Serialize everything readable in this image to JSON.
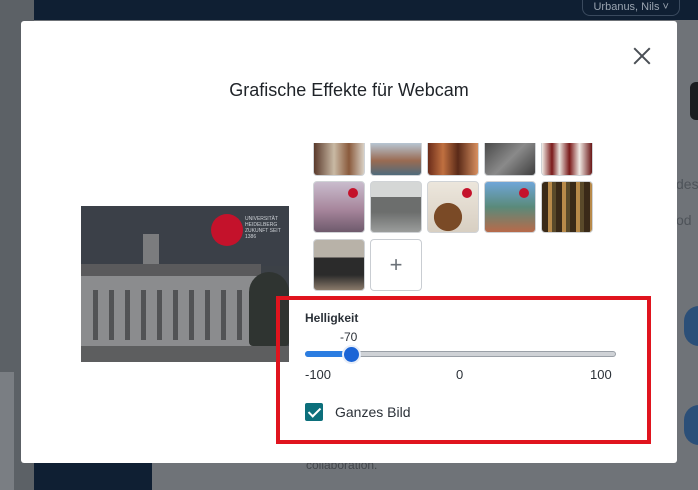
{
  "background": {
    "user_name": "Urbanus, Nils ˅",
    "right_text_1": "des",
    "right_text_2": "od",
    "footer_text": "collaboration."
  },
  "dialog": {
    "title": "Grafische Effekte für Webcam",
    "close_icon": "close-icon"
  },
  "preview": {
    "logo_text": "UNIVERSITÄT HEIDELBERG ZUKUNFT SEIT 1386"
  },
  "thumbnails": [
    {
      "name": "interior-hall",
      "selected": false
    },
    {
      "name": "bridge-river",
      "selected": false
    },
    {
      "name": "library-wood",
      "selected": false
    },
    {
      "name": "grey-texture",
      "selected": false
    },
    {
      "name": "bookshelf-red",
      "selected": false
    },
    {
      "name": "castle-mist",
      "selected": false
    },
    {
      "name": "office-windows",
      "selected": false
    },
    {
      "name": "building-entrance",
      "selected": false
    },
    {
      "name": "city-aerial",
      "selected": false
    },
    {
      "name": "library-shelves",
      "selected": false
    },
    {
      "name": "modern-room",
      "selected": false
    }
  ],
  "add_button_label": "+",
  "brightness": {
    "label": "Helligkeit",
    "value": -70,
    "value_text": "-70",
    "min": -100,
    "max": 100,
    "min_label": "-100",
    "mid_label": "0",
    "max_label": "100"
  },
  "whole_image": {
    "label": "Ganzes Bild",
    "checked": true
  },
  "colors": {
    "accent": "#1a64d6",
    "checkbox": "#0c6f7b",
    "highlight": "#e0141e",
    "brand_red": "#c4122b"
  }
}
